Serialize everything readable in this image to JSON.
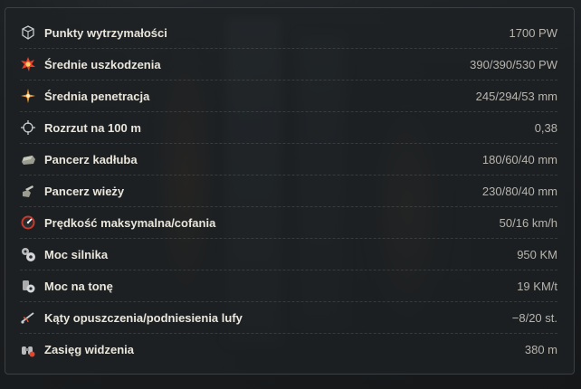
{
  "stats": [
    {
      "icon": "hit-points-icon",
      "label": "Punkty wytrzymałości",
      "value": "1700 PW"
    },
    {
      "icon": "average-damage-icon",
      "label": "Średnie uszkodzenia",
      "value": "390/390/530 PW"
    },
    {
      "icon": "average-penetration-icon",
      "label": "Średnia penetracja",
      "value": "245/294/53 mm"
    },
    {
      "icon": "dispersion-icon",
      "label": "Rozrzut na 100 m",
      "value": "0,38"
    },
    {
      "icon": "hull-armor-icon",
      "label": "Pancerz kadłuba",
      "value": "180/60/40 mm"
    },
    {
      "icon": "turret-armor-icon",
      "label": "Pancerz wieży",
      "value": "230/80/40 mm"
    },
    {
      "icon": "speed-gauge-icon",
      "label": "Prędkość maksymalna/cofania",
      "value": "50/16 km/h"
    },
    {
      "icon": "engine-power-icon",
      "label": "Moc silnika",
      "value": "950 KM"
    },
    {
      "icon": "power-to-weight-icon",
      "label": "Moc na tonę",
      "value": "19 KM/t"
    },
    {
      "icon": "gun-elevation-icon",
      "label": "Kąty opuszczenia/podniesienia lufy",
      "value": "−8/20 st."
    },
    {
      "icon": "view-range-icon",
      "label": "Zasięg widzenia",
      "value": "380 m"
    }
  ]
}
